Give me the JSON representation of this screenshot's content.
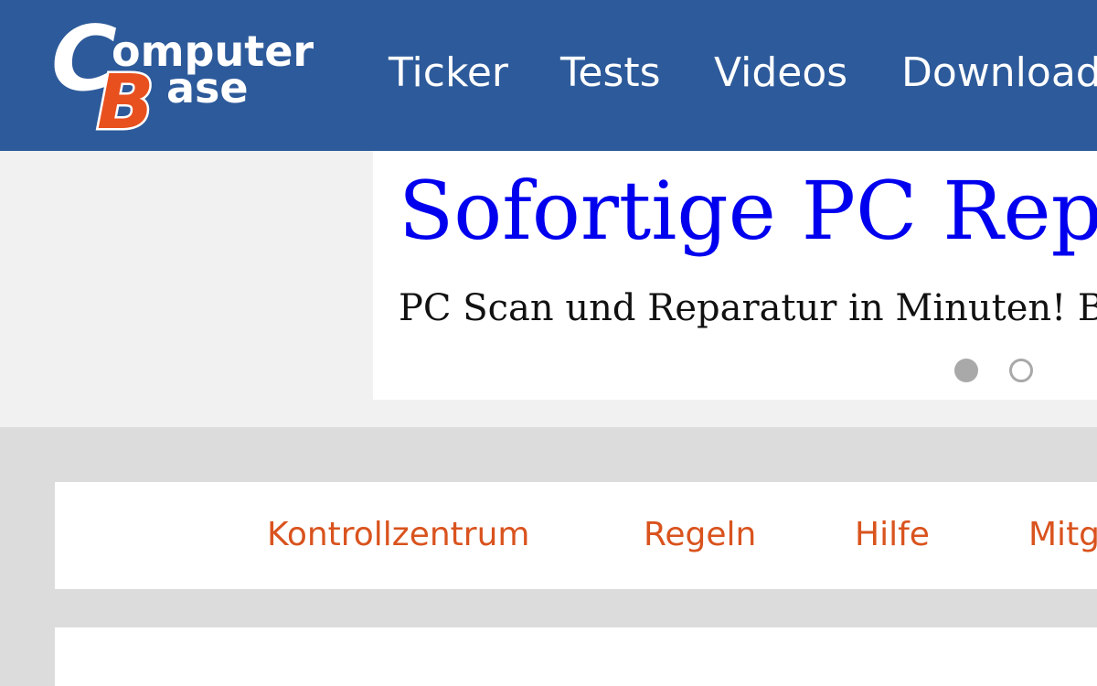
{
  "header": {
    "logo": {
      "text_line1": "omputer",
      "text_line2": "ase",
      "letter_c": "C",
      "letter_b": "B",
      "brand_color": "#2d5a9a",
      "accent_color": "#e8501e"
    },
    "nav": [
      {
        "label": "Ticker"
      },
      {
        "label": "Tests"
      },
      {
        "label": "Videos"
      },
      {
        "label": "Download"
      }
    ]
  },
  "ad": {
    "headline": "Sofortige PC Repa",
    "subline": "PC Scan und Reparatur in Minuten! Befol",
    "carousel": {
      "total_dots": 2,
      "active_index": 0
    }
  },
  "subnav": {
    "items": [
      {
        "label": "Kontrollzentrum"
      },
      {
        "label": "Regeln"
      },
      {
        "label": "Hilfe"
      },
      {
        "label": "Mitg"
      }
    ],
    "link_color": "#d9531e"
  }
}
